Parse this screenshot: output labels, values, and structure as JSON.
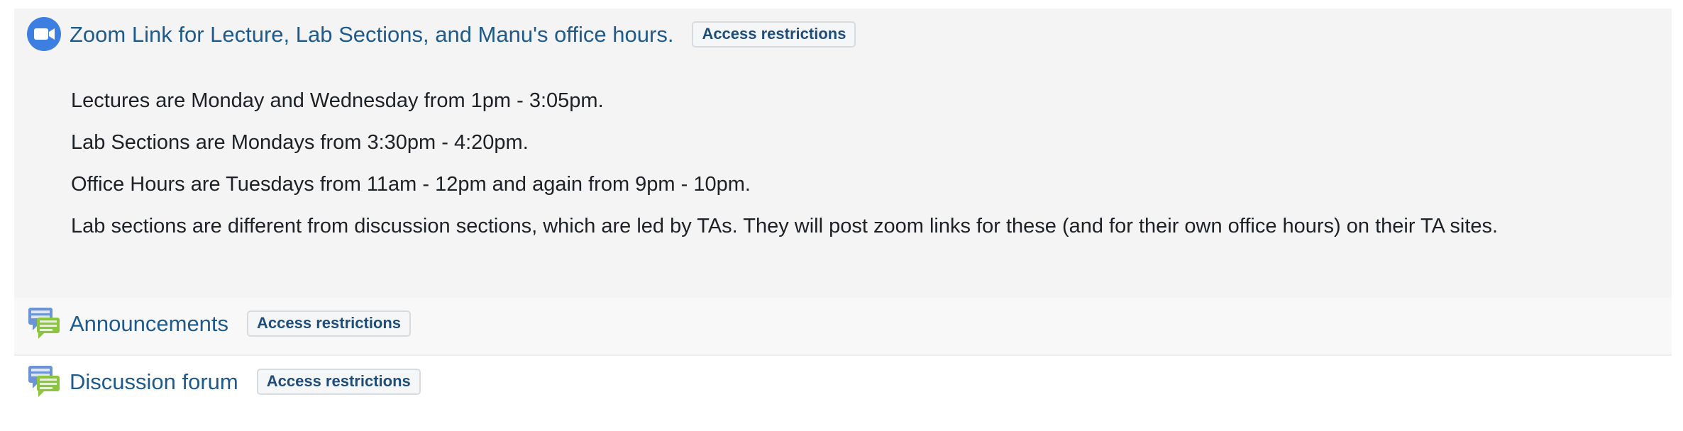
{
  "activities": [
    {
      "icon": "zoom-video-icon",
      "title": "Zoom Link for Lecture, Lab Sections, and Manu's office hours.",
      "badge": "Access restrictions",
      "description": [
        "Lectures are Monday and Wednesday from 1pm - 3:05pm.",
        "Lab Sections are Mondays from 3:30pm - 4:20pm.",
        "Office Hours are Tuesdays from 11am - 12pm and again from 9pm - 10pm.",
        "Lab sections are different from discussion sections, which are led by TAs. They will post zoom links for these (and for their own office hours) on their TA sites."
      ]
    },
    {
      "icon": "forum-chat-icon",
      "title": "Announcements",
      "badge": "Access restrictions"
    },
    {
      "icon": "forum-chat-icon",
      "title": "Discussion forum",
      "badge": "Access restrictions"
    }
  ],
  "colors": {
    "link": "#1f5a8c",
    "badge_text": "#1f4d7a",
    "zoom_blue": "#3d7fe0",
    "chat_blue": "#6b93d6",
    "chat_green": "#8cc63f"
  }
}
